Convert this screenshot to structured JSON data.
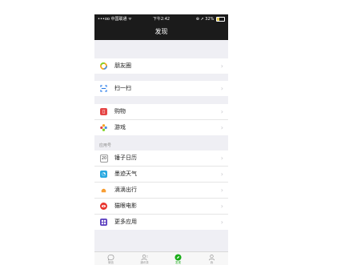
{
  "status_bar": {
    "carrier": "•••oo 中国联通 ᯤ",
    "time": "下午2:42",
    "right": "⊕ ➚ 32%",
    "battery_level": 0.32
  },
  "nav": {
    "title": "发现"
  },
  "groups": [
    [
      {
        "label": "朋友圈",
        "icon": "moments-icon"
      }
    ],
    [
      {
        "label": "扫一扫",
        "icon": "scan-icon"
      }
    ],
    [
      {
        "label": "购物",
        "icon": "shopping-icon"
      },
      {
        "label": "游戏",
        "icon": "games-icon"
      }
    ]
  ],
  "apps_section": {
    "title": "应用号",
    "items": [
      {
        "label": "锤子日历",
        "icon": "calendar-icon"
      },
      {
        "label": "墨迹天气",
        "icon": "weather-icon"
      },
      {
        "label": "滴滴出行",
        "icon": "didi-icon"
      },
      {
        "label": "猫眼电影",
        "icon": "movie-icon"
      },
      {
        "label": "更多应用",
        "icon": "more-apps-icon"
      }
    ]
  },
  "tabbar": {
    "tabs": [
      {
        "label": "微信",
        "icon": "chat-icon"
      },
      {
        "label": "通讯录",
        "icon": "contacts-icon"
      },
      {
        "label": "发现",
        "icon": "discover-icon"
      },
      {
        "label": "我",
        "icon": "me-icon"
      }
    ],
    "active_index": 2
  },
  "colors": {
    "accent": "#1aad19",
    "topbar": "#1b1b1b",
    "background": "#efeff4"
  }
}
